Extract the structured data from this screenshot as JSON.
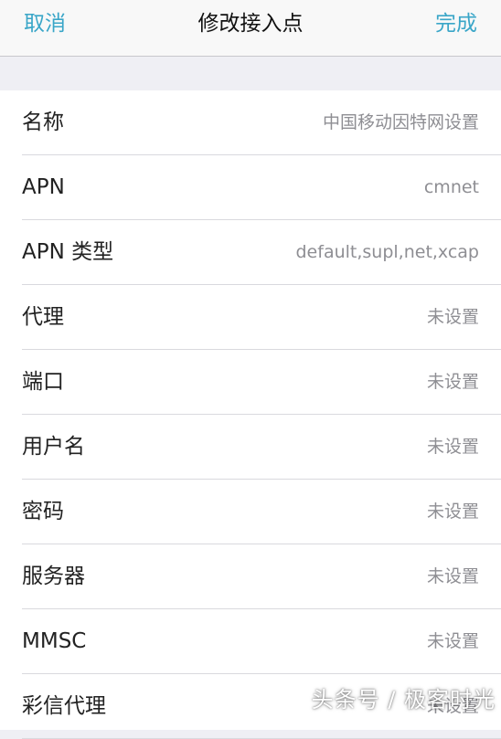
{
  "navbar": {
    "cancel_label": "取消",
    "title": "修改接入点",
    "done_label": "完成"
  },
  "rows": [
    {
      "label": "名称",
      "value": "中国移动因特网设置"
    },
    {
      "label": "APN",
      "value": "cmnet"
    },
    {
      "label": "APN 类型",
      "value": "default,supl,net,xcap"
    },
    {
      "label": "代理",
      "value": "未设置"
    },
    {
      "label": "端口",
      "value": "未设置"
    },
    {
      "label": "用户名",
      "value": "未设置"
    },
    {
      "label": "密码",
      "value": "未设置"
    },
    {
      "label": "服务器",
      "value": "未设置"
    },
    {
      "label": "MMSC",
      "value": "未设置"
    },
    {
      "label": "彩信代理",
      "value": "未设置"
    }
  ],
  "watermark": "头条号 / 极客时光",
  "colors": {
    "accent": "#3aa6c8",
    "background": "#efeff4",
    "value_text": "#8e8e93"
  }
}
